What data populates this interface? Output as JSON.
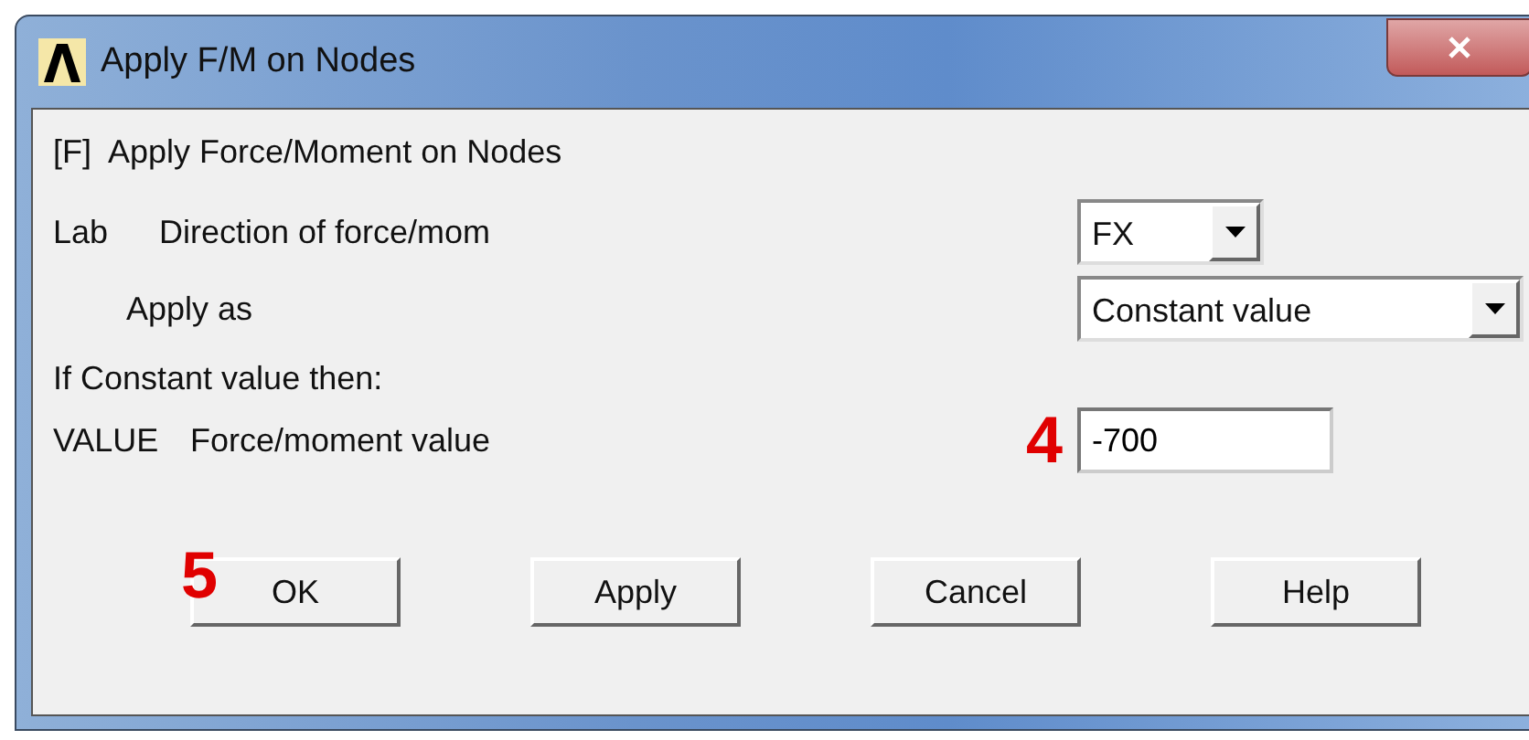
{
  "window": {
    "title": "Apply F/M on Nodes"
  },
  "heading": "[F]  Apply Force/Moment on Nodes",
  "fields": [
    {
      "kind": "select",
      "code": "Lab",
      "label": "Direction of force/mom",
      "value": "FX"
    },
    {
      "kind": "select",
      "label": "Apply as",
      "value": "Constant value"
    },
    {
      "kind": "note",
      "label": "If Constant value then:"
    },
    {
      "kind": "input",
      "code": "VALUE",
      "label": "Force/moment value",
      "value": "-700",
      "annotation": "4"
    }
  ],
  "buttons": [
    {
      "label": "OK",
      "annotation": "5"
    },
    {
      "label": "Apply"
    },
    {
      "label": "Cancel"
    },
    {
      "label": "Help"
    }
  ]
}
